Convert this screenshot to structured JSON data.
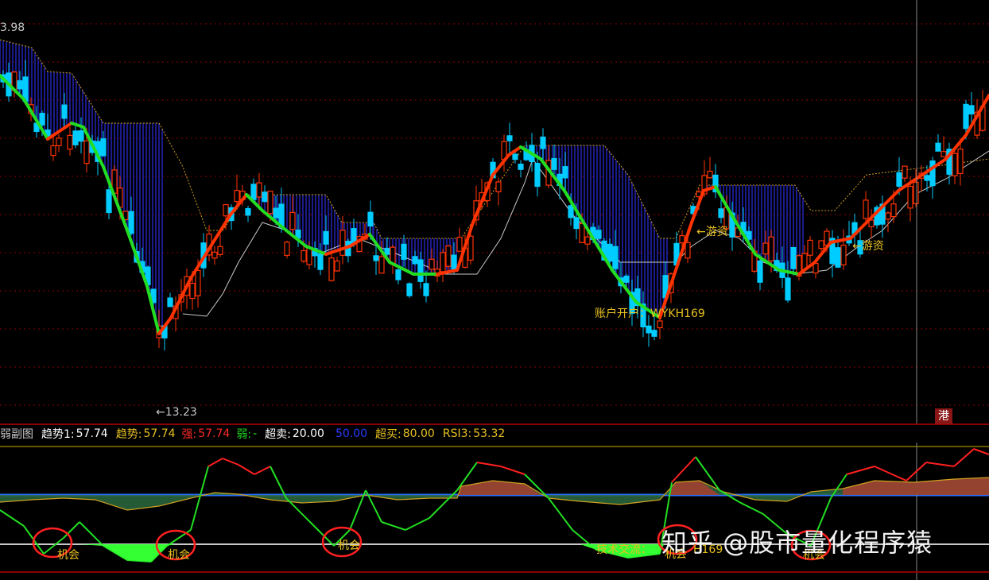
{
  "main_chart": {
    "top_price": "3.98",
    "low_price": "←13.23",
    "annotations": [
      {
        "text": "←游资"
      },
      {
        "text": "←游资"
      },
      {
        "text": "账户开户：WYKH169"
      }
    ],
    "port_badge": "港"
  },
  "indicator_bar": {
    "title": "弱副图",
    "items": [
      {
        "label": "趋势1:",
        "value": "57.74",
        "color": "#ffffff"
      },
      {
        "label": "趋势:",
        "value": "57.74",
        "color": "#e8c020"
      },
      {
        "label": "强:",
        "value": "57.74",
        "color": "#ff2a2a"
      },
      {
        "label": "弱:",
        "value": "-",
        "color": "#22dd22"
      },
      {
        "label": "超卖:",
        "value": "20.00",
        "color": "#ffffff"
      },
      {
        "label": "",
        "value": "50.00",
        "color": "#2a3cff"
      },
      {
        "label": "超买:",
        "value": "80.00",
        "color": "#e8c020"
      },
      {
        "label": "RSI3:",
        "value": "53.32",
        "color": "#e8c020"
      }
    ]
  },
  "sub_chart": {
    "opportunity_labels": [
      {
        "text": "机会"
      },
      {
        "text": "机会"
      },
      {
        "text": "机会"
      },
      {
        "text": "机会"
      },
      {
        "text": "机会"
      }
    ],
    "tech_label": "技术交流：",
    "tech_id": "H169"
  },
  "watermark": "知乎 @股市量化程序猿",
  "colors": {
    "up": "#ff3300",
    "down": "#00ccff",
    "trend_up": "#ff3300",
    "trend_down": "#22dd22",
    "fill": "#1a1a8a",
    "dotline": "#d0a020",
    "baseline": "#c8c8c8",
    "grid": "#8b0000"
  }
}
